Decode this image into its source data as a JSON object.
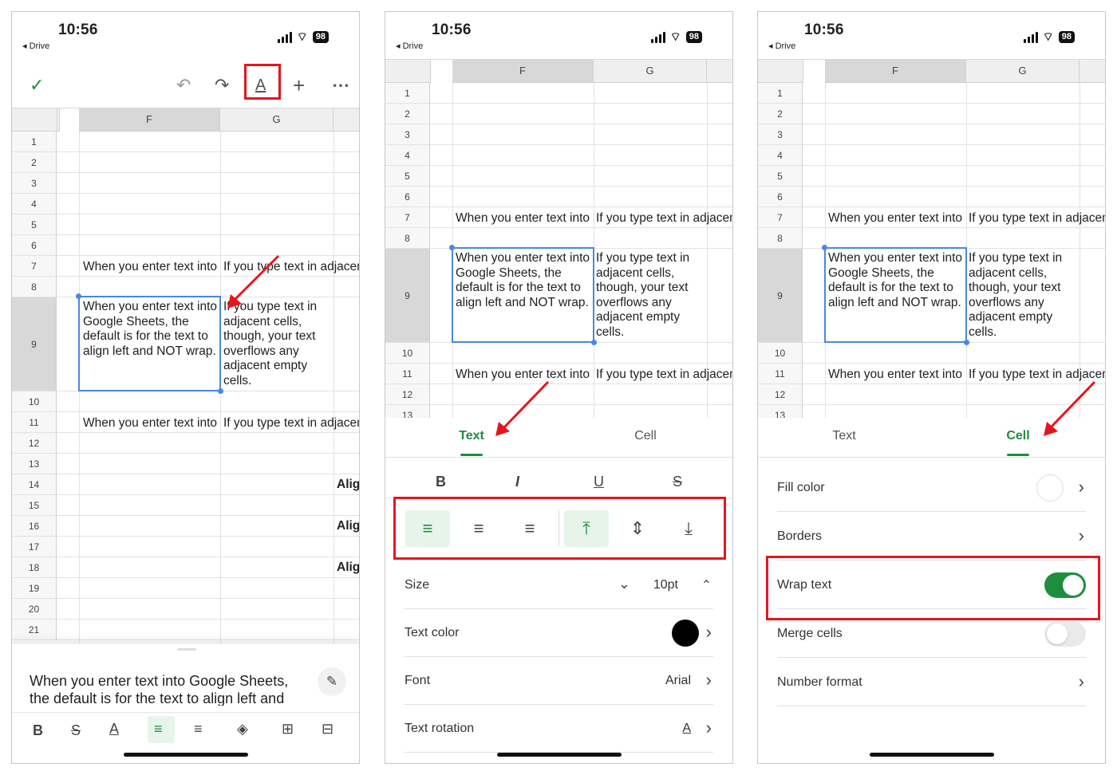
{
  "status": {
    "time": "10:56",
    "back_label": "Drive",
    "battery": "98"
  },
  "columns": [
    "F",
    "G"
  ],
  "row_numbers_p1": [
    "1",
    "2",
    "3",
    "4",
    "5",
    "6",
    "7",
    "8",
    "9",
    "10",
    "11",
    "12",
    "13",
    "14",
    "15",
    "16",
    "17",
    "18",
    "19",
    "20",
    "21"
  ],
  "row_numbers_p23": [
    "1",
    "2",
    "3",
    "4",
    "5",
    "6",
    "7",
    "8",
    "9",
    "10",
    "11",
    "12",
    "13"
  ],
  "cells": {
    "f7": "When you enter text into Google Sheets, the default is for the text to align left and NOT wrap.",
    "g7": "If you type text in adjacent cells, though, your text overflows any adjacent empty cells.",
    "f9": "When you enter text into Google Sheets, the default is for the text to align left and NOT wrap.",
    "g9": "If you type text in adjacent cells, though, your text overflows any adjacent empty cells.",
    "f11": "When you enter text into Google Sheets, the default is for the text to align left and NOT wrap.",
    "g11": "If you type text in adjacent cells, though, your text overflows any adjacent empty cells.",
    "h14": "Alig",
    "h16": "Alig",
    "h18": "Alig"
  },
  "edit_bar": {
    "text": "When you enter text into Google Sheets, the default is for the text to align left and"
  },
  "tabs": {
    "text": "Text",
    "cell": "Cell"
  },
  "text_panel": {
    "size_label": "Size",
    "size_value": "10pt",
    "color_label": "Text color",
    "font_label": "Font",
    "font_value": "Arial",
    "rotation_label": "Text rotation"
  },
  "cell_panel": {
    "fill_label": "Fill color",
    "borders_label": "Borders",
    "wrap_label": "Wrap text",
    "wrap_on": true,
    "merge_label": "Merge cells",
    "merge_on": false,
    "number_label": "Number format"
  },
  "colors": {
    "accent": "#1e8e3e",
    "selection": "#4a86e8",
    "highlight": "#e8141c"
  },
  "icons": [
    "check-icon",
    "undo-icon",
    "redo-icon",
    "text-format-icon",
    "plus-icon",
    "more-icon",
    "bold-icon",
    "italic-icon",
    "underline-icon",
    "strikethrough-icon",
    "align-left-icon",
    "align-center-icon",
    "align-right-icon",
    "valign-top-icon",
    "valign-middle-icon",
    "valign-bottom-icon",
    "fill-color-icon",
    "pencil-icon",
    "chevron-right-icon",
    "chevron-down-icon",
    "chevron-up-icon"
  ]
}
